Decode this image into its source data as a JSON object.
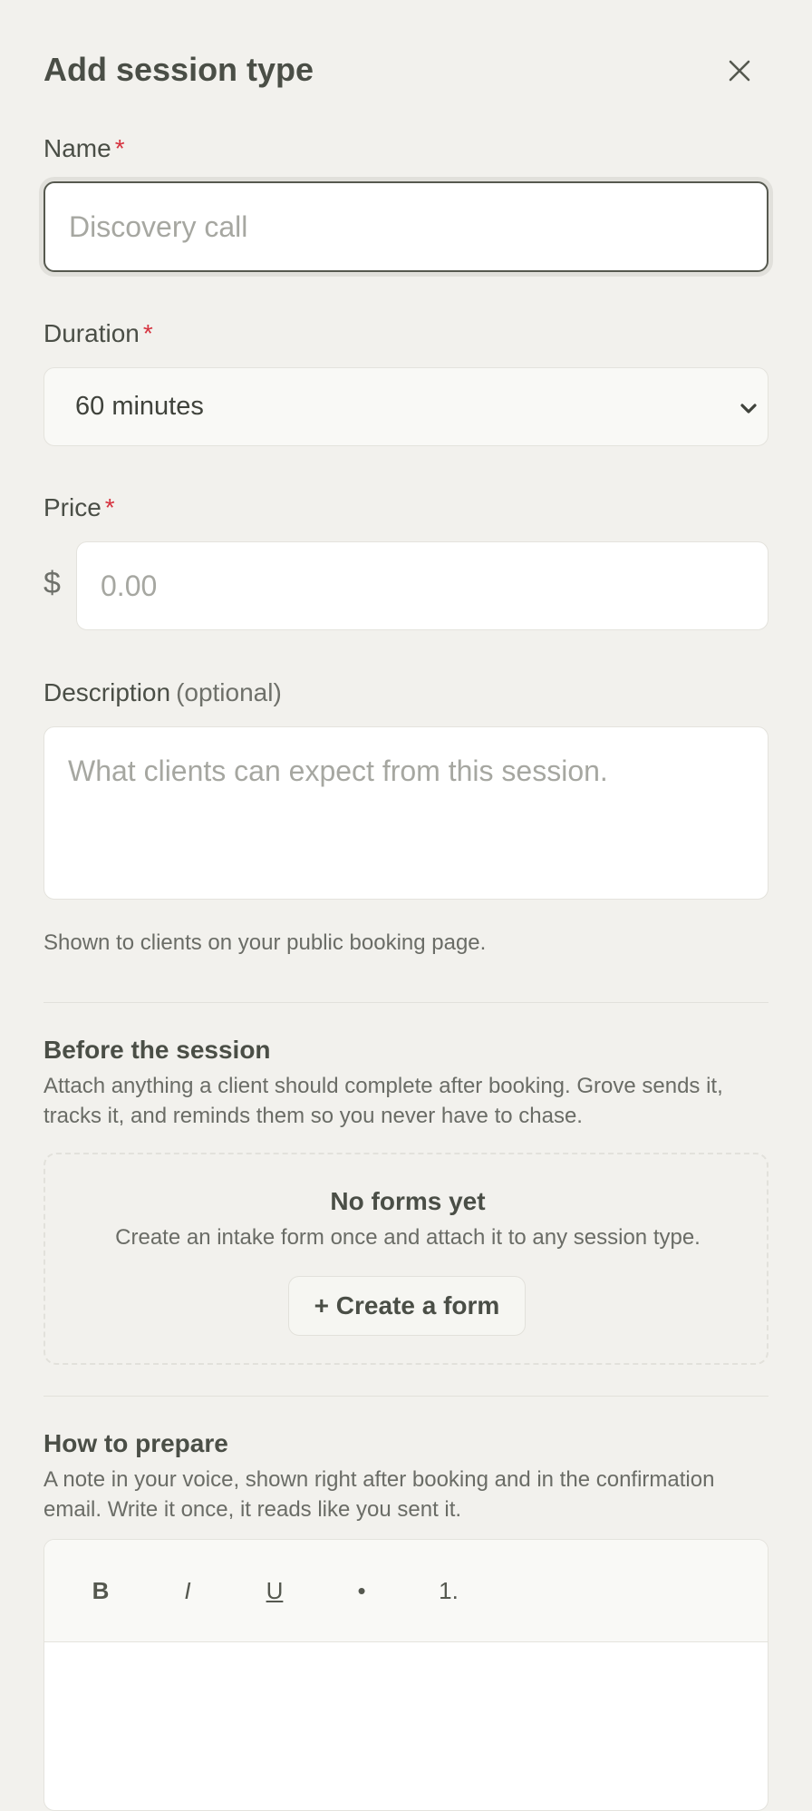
{
  "dialog": {
    "title": "Add session type"
  },
  "name_field": {
    "label": "Name",
    "required_mark": "*",
    "placeholder": "Discovery call"
  },
  "duration_field": {
    "label": "Duration",
    "required_mark": "*",
    "selected": "60 minutes"
  },
  "price_field": {
    "label": "Price",
    "required_mark": "*",
    "currency_symbol": "$",
    "placeholder": "0.00"
  },
  "description_field": {
    "label": "Description",
    "optional_note": "(optional)",
    "placeholder": "What clients can expect from this session.",
    "help_text": "Shown to clients on your public booking page."
  },
  "before_session": {
    "title": "Before the session",
    "description": "Attach anything a client should complete after booking. Grove sends it, tracks it, and reminds them so you never have to chase.",
    "empty_title": "No forms yet",
    "empty_description": "Create an intake form once and attach it to any session type.",
    "create_button": "+ Create a form"
  },
  "how_to_prepare": {
    "title": "How to prepare",
    "description": "A note in your voice, shown right after booking and in the confirmation email. Write it once, it reads like you sent it.",
    "toolbar": {
      "bold": "B",
      "italic": "I",
      "underline": "U",
      "bullet": "•",
      "numbered": "1."
    }
  },
  "colors": {
    "background": "#f2f1ed",
    "required": "#d6333f",
    "text": "#4a4e46"
  }
}
